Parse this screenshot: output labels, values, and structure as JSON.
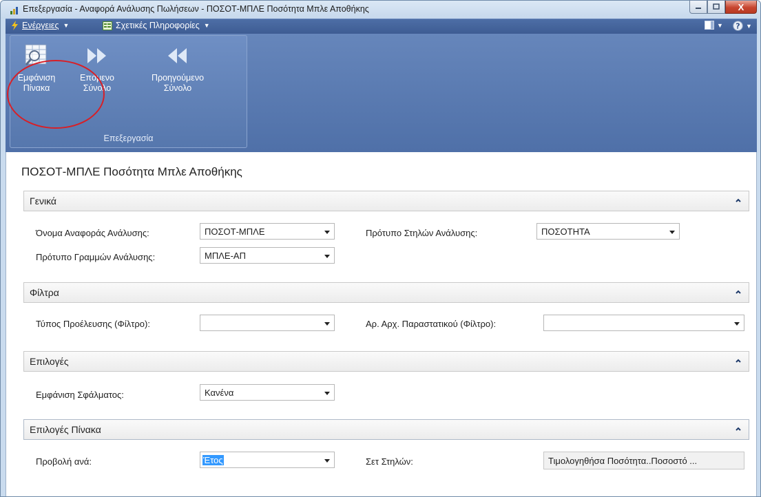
{
  "window": {
    "title": "Επεξεργασία - Αναφορά Ανάλυσης Πωλήσεων - ΠΟΣΟΤ-ΜΠΛΕ Ποσότητα Μπλε Αποθήκης",
    "close_label": "X"
  },
  "menubar": {
    "actions_label": "Ενέργειες",
    "related_info_label": "Σχετικές Πληροφορίες"
  },
  "ribbon": {
    "group_label": "Επεξεργασία",
    "show_matrix": {
      "line1": "Εμφάνιση",
      "line2": "Πίνακα"
    },
    "next_set": {
      "line1": "Επόμενο",
      "line2": "Σύνολο"
    },
    "previous_set": {
      "line1": "Προηγούμενο",
      "line2": "Σύνολο"
    }
  },
  "page": {
    "title": "ΠΟΣΟΤ-ΜΠΛΕ Ποσότητα Μπλε Αποθήκης"
  },
  "general": {
    "header": "Γενικά",
    "analysis_report_name_label": "Όνομα Αναφοράς Ανάλυσης:",
    "analysis_report_name_value": "ΠΟΣΟΤ-ΜΠΛΕ",
    "analysis_line_template_label": "Πρότυπο Γραμμών Ανάλυσης:",
    "analysis_line_template_value": "ΜΠΛΕ-ΑΠ",
    "analysis_column_template_label": "Πρότυπο Στηλών Ανάλυσης:",
    "analysis_column_template_value": "ΠΟΣΟΤΗΤΑ"
  },
  "filters": {
    "header": "Φίλτρα",
    "source_type_filter_label": "Τύπος Προέλευσης (Φίλτρο):",
    "source_type_filter_value": "",
    "source_no_filter_label": "Αρ. Αρχ. Παραστατικού (Φίλτρο):",
    "source_no_filter_value": ""
  },
  "options": {
    "header": "Επιλογές",
    "show_error_label": "Εμφάνιση Σφάλματος:",
    "show_error_value": "Κανένα"
  },
  "matrix_options": {
    "header": "Επιλογές Πίνακα",
    "view_by_label": "Προβολή ανά:",
    "view_by_value": "Έτος",
    "column_set_label": "Σετ Στηλών:",
    "column_set_value": "Τιμολογηθήσα Ποσότητα..Ποσοστό ..."
  },
  "colors": {
    "ribbon": "#5677ad",
    "menubar": "#4d6ea6",
    "highlight_circle": "#d81f26",
    "selection": "#3399ff"
  }
}
